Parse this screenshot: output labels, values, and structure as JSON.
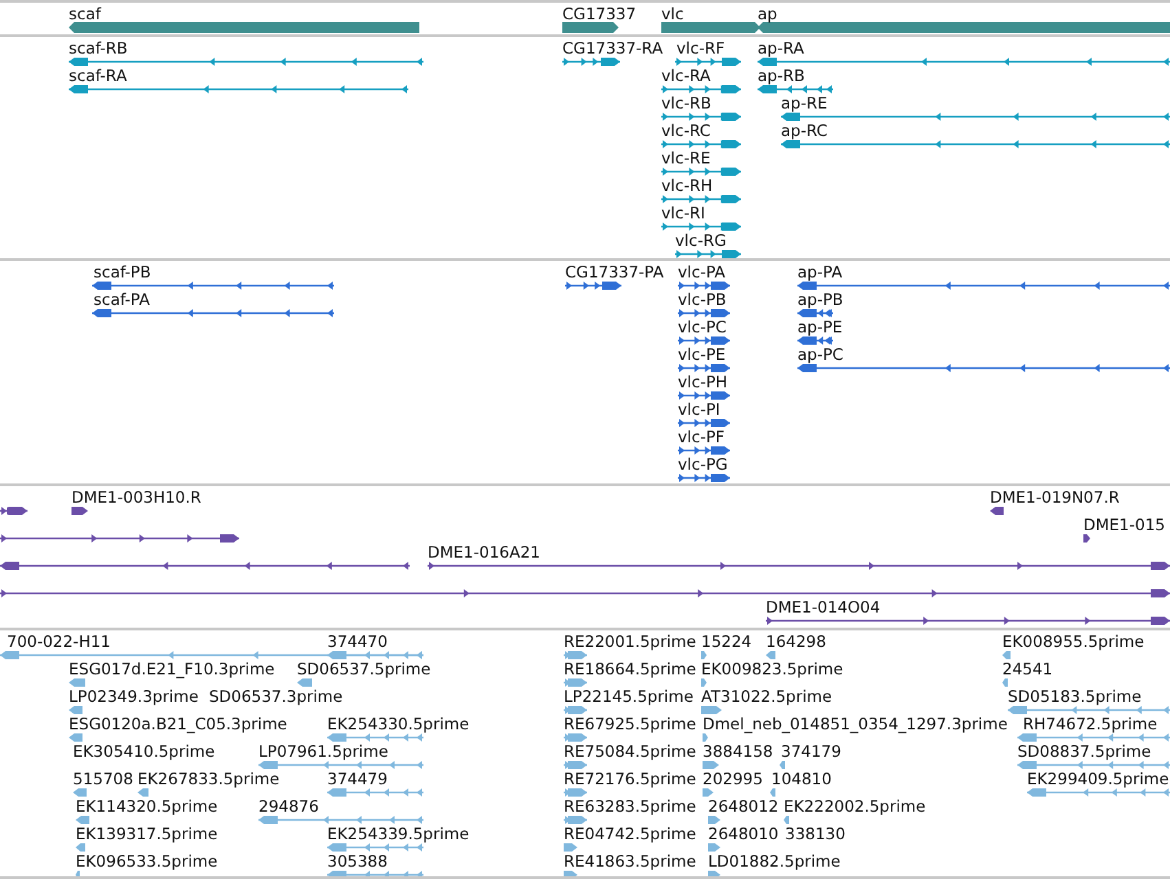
{
  "tracks": [
    {
      "kind": "gene",
      "color": "#3f8f8f",
      "features": [
        {
          "label": "scaf"
        },
        {
          "label": "CG17337"
        },
        {
          "label": "vlc"
        },
        {
          "label": "ap"
        }
      ]
    },
    {
      "kind": "transcript",
      "color": "#169fc1",
      "features": [
        {
          "label": "scaf-RB"
        },
        {
          "label": "scaf-RA"
        },
        {
          "label": "CG17337-RA"
        },
        {
          "label": "vlc-RF"
        },
        {
          "label": "vlc-RA"
        },
        {
          "label": "vlc-RB"
        },
        {
          "label": "vlc-RC"
        },
        {
          "label": "vlc-RE"
        },
        {
          "label": "vlc-RH"
        },
        {
          "label": "vlc-RI"
        },
        {
          "label": "vlc-RG"
        },
        {
          "label": "ap-RA"
        },
        {
          "label": "ap-RB"
        },
        {
          "label": "ap-RE"
        },
        {
          "label": "ap-RC"
        }
      ]
    },
    {
      "kind": "protein",
      "color": "#2f6fd6",
      "features": [
        {
          "label": "scaf-PB"
        },
        {
          "label": "scaf-PA"
        },
        {
          "label": "CG17337-PA"
        },
        {
          "label": "vlc-PA"
        },
        {
          "label": "vlc-PB"
        },
        {
          "label": "vlc-PC"
        },
        {
          "label": "vlc-PE"
        },
        {
          "label": "vlc-PH"
        },
        {
          "label": "vlc-PI"
        },
        {
          "label": "vlc-PF"
        },
        {
          "label": "vlc-PG"
        },
        {
          "label": "ap-PA"
        },
        {
          "label": "ap-PB"
        },
        {
          "label": "ap-PE"
        },
        {
          "label": "ap-PC"
        }
      ]
    },
    {
      "kind": "clone",
      "color": "#6b4ea8",
      "features": [
        {
          "label": "DME1-003H10.R"
        },
        {
          "label": "DME1-019N07.R"
        },
        {
          "label": "DME1-015"
        },
        {
          "label": "DME1-016A21"
        },
        {
          "label": "DME1-014O04"
        }
      ]
    },
    {
      "kind": "est",
      "color": "#80b8de",
      "features": [
        {
          "label": "700-022-H11"
        },
        {
          "label": "374470"
        },
        {
          "label": "ESG017d.E21_F10.3prime"
        },
        {
          "label": "SD06537.5prime"
        },
        {
          "label": "LP02349.3prime"
        },
        {
          "label": "SD06537.3prime"
        },
        {
          "label": "ESG0120a.B21_C05.3prime"
        },
        {
          "label": "EK254330.5prime"
        },
        {
          "label": "EK305410.5prime"
        },
        {
          "label": "LP07961.5prime"
        },
        {
          "label": "515708"
        },
        {
          "label": "EK267833.5prime"
        },
        {
          "label": "374479"
        },
        {
          "label": "EK114320.5prime"
        },
        {
          "label": "294876"
        },
        {
          "label": "EK139317.5prime"
        },
        {
          "label": "EK254339.5prime"
        },
        {
          "label": "EK096533.5prime"
        },
        {
          "label": "305388"
        },
        {
          "label": "RE22001.5prime"
        },
        {
          "label": "15224"
        },
        {
          "label": "164298"
        },
        {
          "label": "EK008955.5prime"
        },
        {
          "label": "RE18664.5prime"
        },
        {
          "label": "EK009823.5prime"
        },
        {
          "label": "24541"
        },
        {
          "label": "LP22145.5prime"
        },
        {
          "label": "AT31022.5prime"
        },
        {
          "label": "SD05183.5prime"
        },
        {
          "label": "RE67925.5prime"
        },
        {
          "label": "Dmel_neb_014851_0354_1297.3prime"
        },
        {
          "label": "RH74672.5prime"
        },
        {
          "label": "RE75084.5prime"
        },
        {
          "label": "3884158"
        },
        {
          "label": "374179"
        },
        {
          "label": "SD08837.5prime"
        },
        {
          "label": "RE72176.5prime"
        },
        {
          "label": "202995"
        },
        {
          "label": "104810"
        },
        {
          "label": "EK299409.5prime"
        },
        {
          "label": "RE63283.5prime"
        },
        {
          "label": "2648012"
        },
        {
          "label": "EK222002.5prime"
        },
        {
          "label": "RE04742.5prime"
        },
        {
          "label": "2648010"
        },
        {
          "label": "338130"
        },
        {
          "label": "RE41863.5prime"
        },
        {
          "label": "LD01882.5prime"
        }
      ]
    }
  ]
}
